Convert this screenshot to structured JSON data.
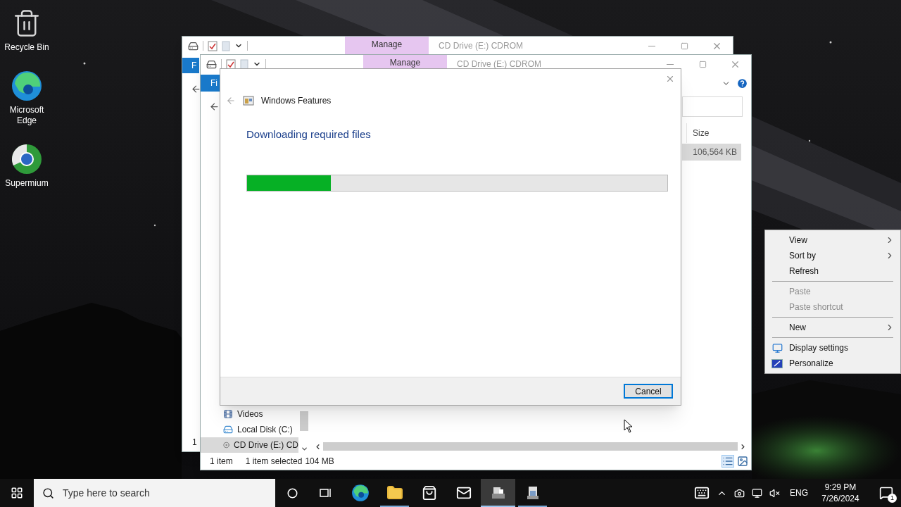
{
  "desktop_icons": [
    {
      "label": "Recycle Bin",
      "kind": "recycle"
    },
    {
      "label": "Microsoft Edge",
      "kind": "edge"
    },
    {
      "label": "Supermium",
      "kind": "supermium"
    }
  ],
  "back_window": {
    "ribbon_tab": "Manage",
    "title": "CD Drive (E:) CDROM",
    "file_tab": "F",
    "status": "1"
  },
  "front_window": {
    "ribbon_tab": "Manage",
    "title": "CD Drive (E:) CDROM",
    "file_tab": "Fi",
    "columns": [
      "Size"
    ],
    "rows": [
      {
        "size": "106,564 KB",
        "selected": true
      }
    ],
    "nav_items": [
      {
        "label": "Videos",
        "kind": "videos",
        "selected": false
      },
      {
        "label": "Local Disk (C:)",
        "kind": "disk",
        "selected": false
      },
      {
        "label": "CD Drive (E:) CD",
        "kind": "cd",
        "selected": true
      }
    ],
    "status": {
      "count": "1 item",
      "selection": "1 item selected",
      "size": "104 MB"
    }
  },
  "dialog": {
    "title": "Windows Features",
    "heading": "Downloading required files",
    "progress": {
      "level": 0.2
    },
    "buttons": [
      "Cancel"
    ]
  },
  "context_menu": {
    "items": [
      {
        "label": "View",
        "kind": "submenu",
        "disabled": false
      },
      {
        "label": "Sort by",
        "kind": "submenu",
        "disabled": false
      },
      {
        "label": "Refresh",
        "kind": "text",
        "disabled": false
      },
      {
        "kind": "separator"
      },
      {
        "label": "Paste",
        "kind": "text",
        "disabled": true
      },
      {
        "label": "Paste shortcut",
        "kind": "text",
        "disabled": true
      },
      {
        "kind": "separator"
      },
      {
        "label": "New",
        "kind": "submenu",
        "disabled": false
      },
      {
        "kind": "separator"
      },
      {
        "label": "Display settings",
        "kind": "display",
        "disabled": false
      },
      {
        "label": "Personalize",
        "kind": "personalize",
        "disabled": false
      }
    ]
  },
  "taskbar": {
    "search_placeholder": "Type here to search",
    "apps": [
      {
        "kind": "edge",
        "running": false,
        "selected": false
      },
      {
        "kind": "folder",
        "running": true,
        "selected": false
      },
      {
        "kind": "store",
        "running": false,
        "selected": false
      },
      {
        "kind": "mail",
        "running": false,
        "selected": false
      },
      {
        "kind": "features",
        "running": true,
        "selected": true
      },
      {
        "kind": "installer",
        "running": true,
        "selected": false
      }
    ],
    "language": "ENG",
    "time": "9:29 PM",
    "date": "7/26/2024",
    "notification_count": "1"
  }
}
